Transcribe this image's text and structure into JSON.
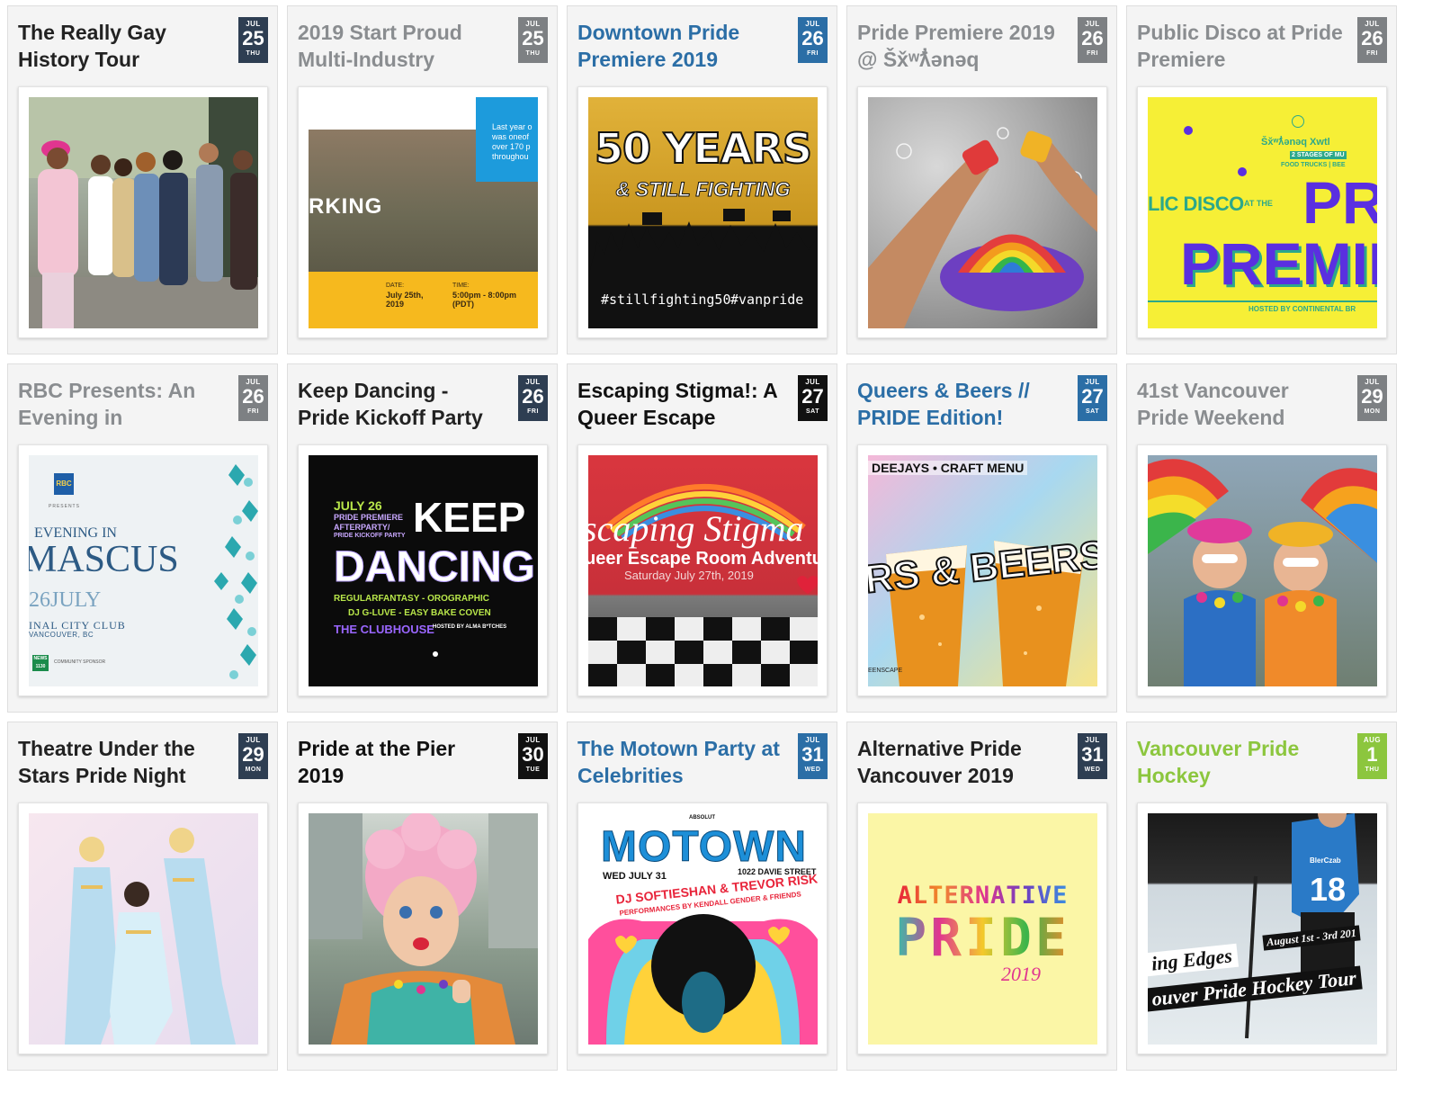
{
  "events": [
    {
      "title": "The Really Gay History Tour",
      "month": "JUL",
      "day": "25",
      "weekday": "THU",
      "title_color": "#222222",
      "date_color": "#2e3e52"
    },
    {
      "title": "2019 Start Proud Multi-Industry",
      "month": "JUL",
      "day": "25",
      "weekday": "THU",
      "title_color": "#8a8d90",
      "date_color": "#7d8083"
    },
    {
      "title": "Downtown Pride Premiere 2019",
      "month": "JUL",
      "day": "26",
      "weekday": "FRI",
      "title_color": "#2b6ea6",
      "date_color": "#2b6ea6"
    },
    {
      "title": "Pride Premiere 2019 @ Šx̌ʷƛ̓ənəq",
      "month": "JUL",
      "day": "26",
      "weekday": "FRI",
      "title_color": "#8a8d90",
      "date_color": "#7d8083"
    },
    {
      "title": "Public Disco at Pride Premiere",
      "month": "JUL",
      "day": "26",
      "weekday": "FRI",
      "title_color": "#8a8d90",
      "date_color": "#7d8083"
    },
    {
      "title": "RBC Presents: An Evening in",
      "month": "JUL",
      "day": "26",
      "weekday": "FRI",
      "title_color": "#8a8d90",
      "date_color": "#7d8083"
    },
    {
      "title": "Keep Dancing - Pride Kickoff Party",
      "month": "JUL",
      "day": "26",
      "weekday": "FRI",
      "title_color": "#222222",
      "date_color": "#2e3e52"
    },
    {
      "title": "Escaping Stigma!: A Queer Escape",
      "month": "JUL",
      "day": "27",
      "weekday": "SAT",
      "title_color": "#111111",
      "date_color": "#111111"
    },
    {
      "title": "Queers & Beers // PRIDE Edition!",
      "month": "JUL",
      "day": "27",
      "weekday": "SAT",
      "title_color": "#2b6ea6",
      "date_color": "#2b6ea6"
    },
    {
      "title": "41st Vancouver Pride Weekend",
      "month": "JUL",
      "day": "29",
      "weekday": "MON",
      "title_color": "#8a8d90",
      "date_color": "#7d8083"
    },
    {
      "title": "Theatre Under the Stars Pride Night",
      "month": "JUL",
      "day": "29",
      "weekday": "MON",
      "title_color": "#222222",
      "date_color": "#2e3e52"
    },
    {
      "title": "Pride at the Pier 2019",
      "month": "JUL",
      "day": "30",
      "weekday": "TUE",
      "title_color": "#111111",
      "date_color": "#111111"
    },
    {
      "title": "The Motown Party at Celebrities",
      "month": "JUL",
      "day": "31",
      "weekday": "WED",
      "title_color": "#2b6ea6",
      "date_color": "#2b6ea6"
    },
    {
      "title": "Alternative Pride Vancouver 2019",
      "month": "JUL",
      "day": "31",
      "weekday": "WED",
      "title_color": "#222222",
      "date_color": "#2e3e52"
    },
    {
      "title": "Vancouver Pride Hockey",
      "month": "AUG",
      "day": "1",
      "weekday": "THU",
      "title_color": "#8cc63e",
      "date_color": "#8cc63e"
    }
  ],
  "posters": {
    "start_proud": {
      "side_text": "Last year o was oneof over 170 p throughou",
      "word": "RKING",
      "date_label": "DATE:",
      "date_value": "July 25th, 2019",
      "time_label": "TIME:",
      "time_value": "5:00pm - 8:00pm (PDT)"
    },
    "fifty_years": {
      "line1": "50 YEARS",
      "line2": "& STILL FIGHTING",
      "tag1": "#stillfighting50",
      "tag2": "#vanpride"
    },
    "disco": {
      "top": "Šx̌ʷƛ̓ənəq Xwtl",
      "sub": "2 STAGES OF MU",
      "sub2": "FOOD TRUCKS | BEE",
      "left": "LIC DISCO",
      "at": "AT THE",
      "pr": "PR",
      "premie": "PREMIE",
      "host": "HOSTED BY CONTINENTAL BR"
    },
    "rbc": {
      "brand": "RBC",
      "presents": "PRESENTS",
      "line1": "EVENING IN",
      "line2": "MASCUS",
      "date": "26JULY",
      "venue": "INAL CITY CLUB",
      "city": "VANCOUVER, BC",
      "sponsor1": "NEWS 1130",
      "sponsor2": "COMMUNITY SPONSOR"
    },
    "keep_dancing": {
      "date": "JULY 26",
      "sub1": "PRIDE PREMIERE",
      "sub2": "AFTERPARTY/",
      "sub3": "PRIDE KICKOFF PARTY",
      "keep": "KEEP",
      "dancing": "DANCING",
      "acts1": "REGULARFANTASY - OROGRAPHIC",
      "acts2": "DJ G-LUVE - EASY BAKE COVEN",
      "venue": "THE CLUBHOUSE",
      "host": "HOSTED BY ALMA B*TCHES"
    },
    "escape": {
      "title": "scaping Stigma",
      "sub": "ueer Escape Room Adventu",
      "date": "Saturday July 27th, 2019"
    },
    "beers": {
      "top": "DEEJAYS • CRAFT MENU",
      "title": "RS & BEERS",
      "footer": "EENSCAPE"
    },
    "motown": {
      "absolut": "ABSOLUT",
      "title": "MOTOWN",
      "date": "WED JULY 31",
      "address": "1022 DAVIE STREET",
      "djs": "DJ SOFTIESHAN & TREVOR RISK",
      "perf": "PERFORMANCES BY KENDALL GENDER & FRIENDS"
    },
    "alt_pride": {
      "line1": "ALTERNATIVE",
      "line2": "PRIDE",
      "year": "2019"
    },
    "hockey": {
      "number": "18",
      "jersey": "BlerCzab",
      "edges": "ing Edges",
      "dates": "August 1st - 3rd 201",
      "tour": "ouver Pride Hockey Tour"
    }
  },
  "colors": {
    "card_bg": "#f4f4f4",
    "border": "#dedede",
    "gray": "#8a8d90",
    "blue": "#2b6ea6",
    "green": "#8cc63e",
    "dark": "#2e3e52",
    "black": "#111111"
  }
}
